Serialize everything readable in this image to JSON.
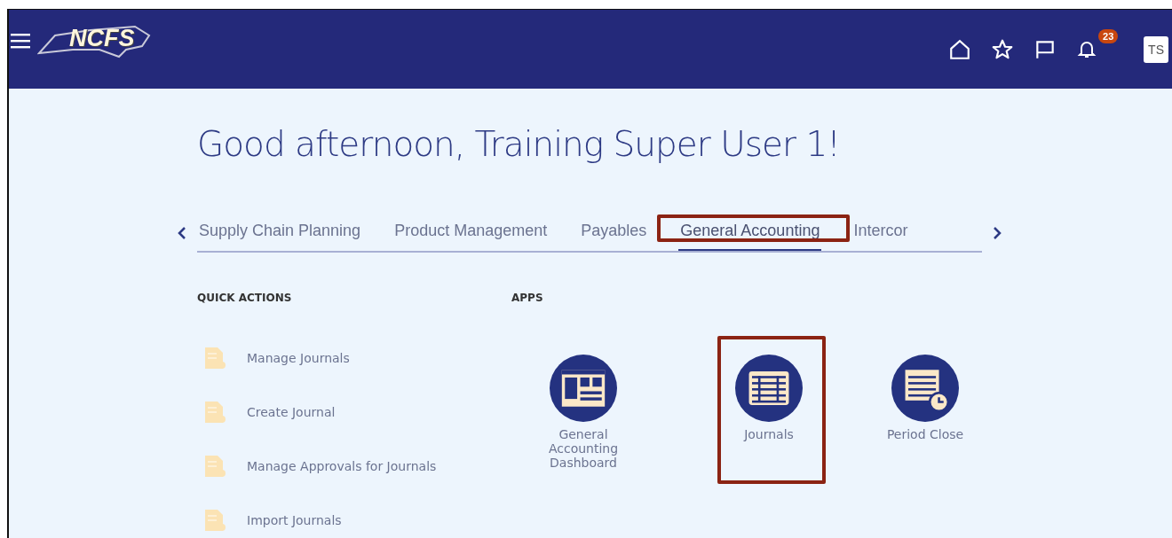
{
  "header": {
    "logo": "NCFS",
    "notifications": "23",
    "avatar": "TS"
  },
  "greeting": "Good afternoon, Training Super User 1!",
  "tabs": [
    {
      "label": "Supply Chain Planning",
      "selected": false,
      "highlighted": false
    },
    {
      "label": "Product Management",
      "selected": false,
      "highlighted": false
    },
    {
      "label": "Payables",
      "selected": false,
      "highlighted": false
    },
    {
      "label": "General Accounting",
      "selected": true,
      "highlighted": true
    },
    {
      "label": "Intercor",
      "selected": false,
      "highlighted": false
    }
  ],
  "quick_actions": {
    "heading": "QUICK ACTIONS",
    "items": [
      {
        "label": "Manage Journals"
      },
      {
        "label": "Create Journal"
      },
      {
        "label": "Manage Approvals for Journals"
      },
      {
        "label": "Import Journals"
      }
    ]
  },
  "apps": {
    "heading": "APPS",
    "items": [
      {
        "label": "General Accounting Dashboard",
        "kind": "dashboard",
        "highlighted": false
      },
      {
        "label": "Journals",
        "kind": "table",
        "highlighted": true
      },
      {
        "label": "Period Close",
        "kind": "clock",
        "highlighted": false
      }
    ]
  }
}
